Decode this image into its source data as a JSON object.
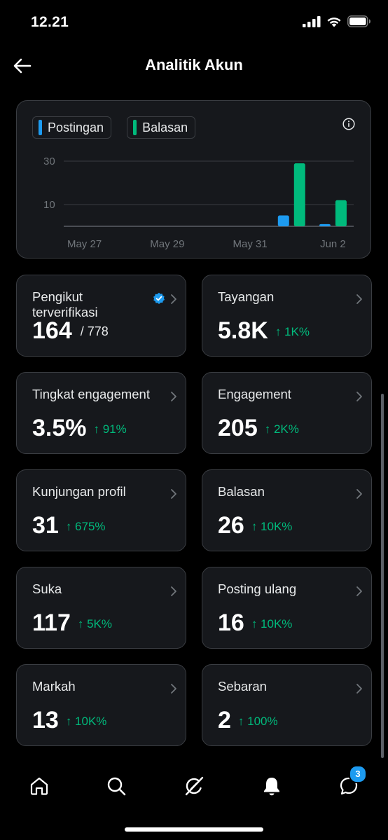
{
  "status": {
    "time": "12.21"
  },
  "header": {
    "title": "Analitik Akun"
  },
  "chart": {
    "legend": [
      "Postingan",
      "Balasan"
    ],
    "colors": {
      "postingan": "#1d9bf0",
      "balasan": "#00ba7c",
      "grid": "#3a3d42",
      "tick": "#71767b"
    }
  },
  "chart_data": {
    "type": "bar",
    "categories": [
      "May 27",
      "May 28",
      "May 29",
      "May 30",
      "May 31",
      "Jun 1",
      "Jun 2"
    ],
    "x_tick_labels": [
      "May 27",
      "May 29",
      "May 31",
      "Jun 2"
    ],
    "y_tick_labels": [
      "30",
      "10"
    ],
    "series": [
      {
        "name": "Postingan",
        "values": [
          0,
          0,
          0,
          0,
          0,
          5,
          1
        ]
      },
      {
        "name": "Balasan",
        "values": [
          0,
          0,
          0,
          0,
          0,
          29,
          12
        ]
      }
    ],
    "ylim": [
      0,
      30
    ],
    "grid": true,
    "legend_position": "top-left"
  },
  "stats": [
    {
      "label": "Pengikut terverifikasi",
      "value": "164",
      "sub": "/ 778",
      "verified": true
    },
    {
      "label": "Tayangan",
      "value": "5.8K",
      "delta": "↑ 1K%"
    },
    {
      "label": "Tingkat engagement",
      "value": "3.5%",
      "delta": "↑ 91%"
    },
    {
      "label": "Engagement",
      "value": "205",
      "delta": "↑ 2K%"
    },
    {
      "label": "Kunjungan profil",
      "value": "31",
      "delta": "↑ 675%"
    },
    {
      "label": "Balasan",
      "value": "26",
      "delta": "↑ 10K%"
    },
    {
      "label": "Suka",
      "value": "117",
      "delta": "↑ 5K%"
    },
    {
      "label": "Posting ulang",
      "value": "16",
      "delta": "↑ 10K%"
    },
    {
      "label": "Markah",
      "value": "13",
      "delta": "↑ 10K%"
    },
    {
      "label": "Sebaran",
      "value": "2",
      "delta": "↑ 100%"
    }
  ],
  "tabbar": {
    "notification_badge": "3"
  }
}
